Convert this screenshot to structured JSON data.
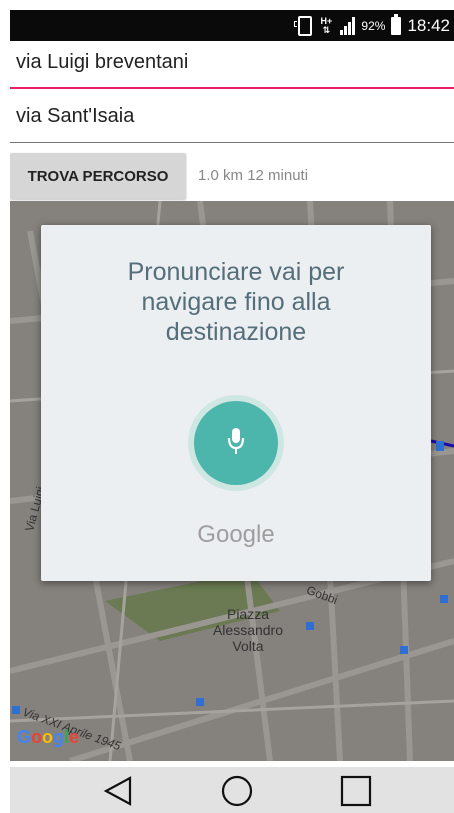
{
  "status_bar": {
    "data_label": "H+",
    "battery": "92%",
    "time": "18:42"
  },
  "route": {
    "origin": "via Luigi breventani",
    "destination": "via Sant'Isaia",
    "button_label": "TROVA PERCORSO",
    "distance": "1.0 km",
    "duration": "12 minuti"
  },
  "map": {
    "street_luigi": "Via Luigi",
    "street_xxi": "Via XXI Aprile 1945",
    "street_gobbi": "Gobbi",
    "piazza": "Piazza Alessandro Volta",
    "piazza_line1": "Piazza",
    "piazza_line2": "Alessandro",
    "piazza_line3": "Volta",
    "attribution": "Google",
    "route_color": "#1a0dab"
  },
  "voice_dialog": {
    "prompt": "Pronunciare vai per navigare fino alla destinazione",
    "prompt_line1": "Pronunciare vai per",
    "prompt_line2": "navigare fino alla",
    "prompt_line3": "destinazione",
    "brand": "Google",
    "mic_color": "#4db6ac"
  },
  "nav_bar": {
    "back_icon": "back-triangle-icon",
    "home_icon": "home-circle-icon",
    "recents_icon": "recents-square-icon"
  }
}
